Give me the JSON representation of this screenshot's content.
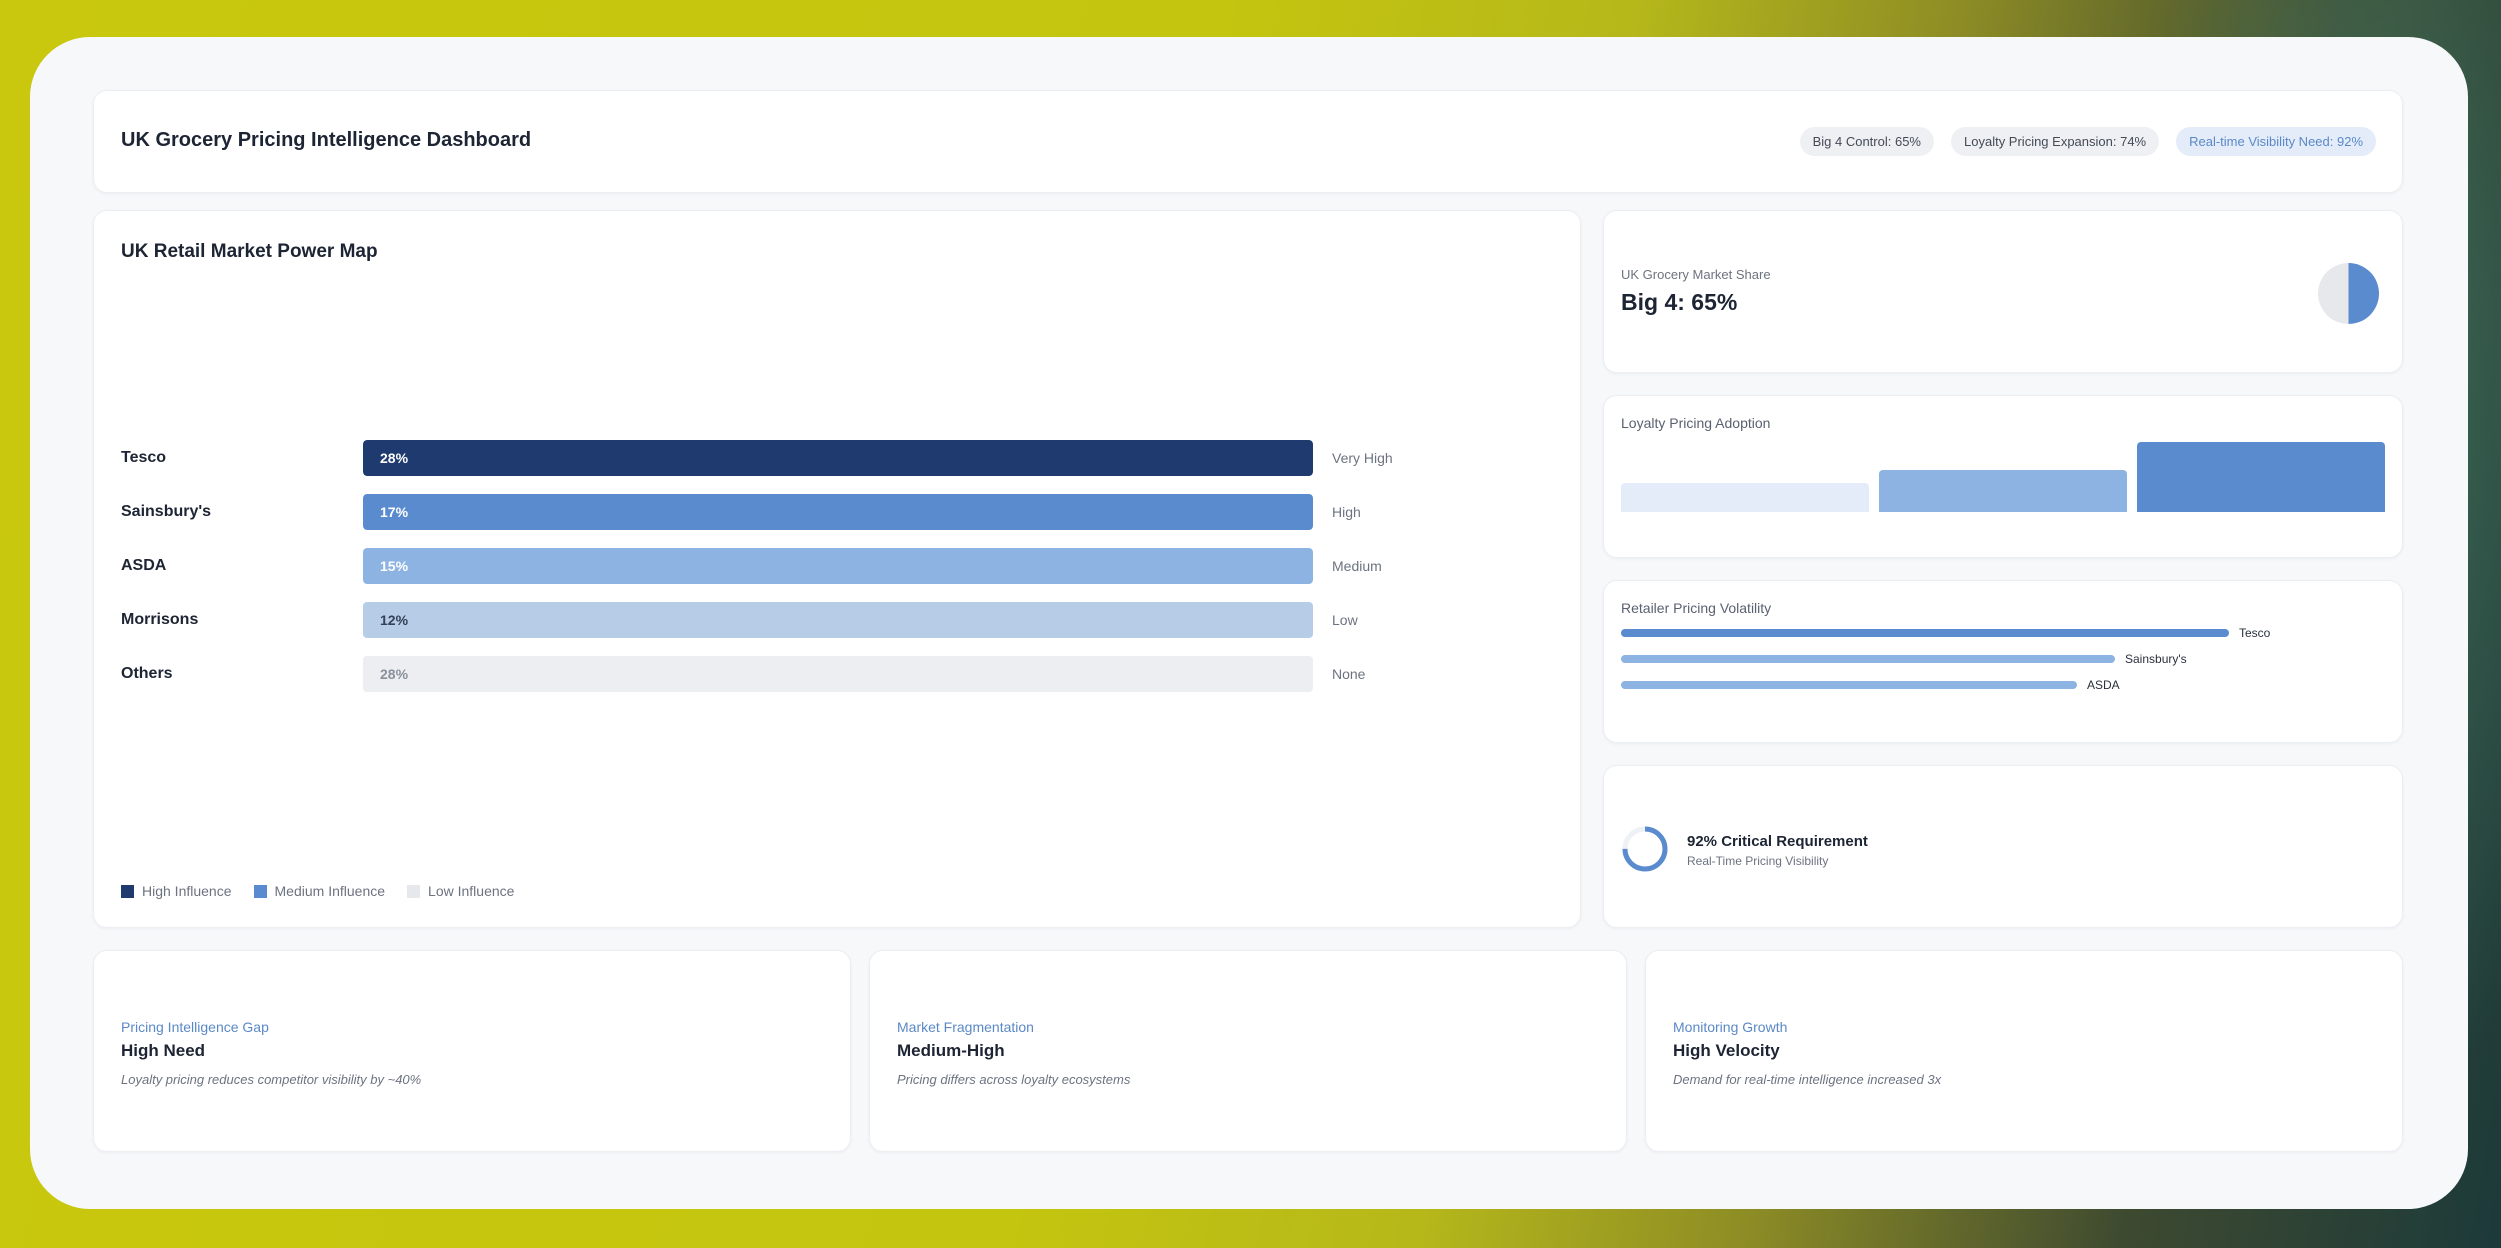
{
  "colors": {
    "high": "#1e3a6e",
    "medium": "#5a8bcf",
    "medium_light": "#8db3e2",
    "low": "#b7cce6",
    "none": "#eceef2",
    "accent": "#5b89c7"
  },
  "header": {
    "title": "UK Grocery Pricing Intelligence Dashboard",
    "pills": [
      {
        "label": "Big 4 Control: 65%"
      },
      {
        "label": "Loyalty Pricing Expansion: 74%"
      },
      {
        "label": "Real-time Visibility Need: 92%"
      }
    ]
  },
  "power_map": {
    "title": "UK Retail Market Power Map",
    "rows": [
      {
        "name": "Tesco",
        "value_label": "28%",
        "fill": 1.0,
        "level": "Very High",
        "color": "#1e3a6e",
        "text_color": "#ffffff"
      },
      {
        "name": "Sainsbury's",
        "value_label": "17%",
        "fill": 1.0,
        "level": "High",
        "color": "#5a8bcf",
        "text_color": "#ffffff"
      },
      {
        "name": "ASDA",
        "value_label": "15%",
        "fill": 1.0,
        "level": "Medium",
        "color": "#8db3e2",
        "text_color": "#ffffff"
      },
      {
        "name": "Morrisons",
        "value_label": "12%",
        "fill": 1.0,
        "level": "Low",
        "color": "#b7cce6",
        "text_color": "#33415a"
      },
      {
        "name": "Others",
        "value_label": "28%",
        "fill": 1.0,
        "level": "None",
        "color": "#eceef2",
        "text_color": "#8a909b"
      }
    ],
    "legend": [
      {
        "label": "High Influence",
        "color": "#1e3a6e"
      },
      {
        "label": "Medium Influence",
        "color": "#5a8bcf"
      },
      {
        "label": "Low Influence",
        "color": "#e6e8ec"
      }
    ]
  },
  "market_share": {
    "label": "UK Grocery Market Share",
    "value": "Big 4: 65%",
    "pie_fraction": 0.5
  },
  "loyalty": {
    "title": "Loyalty Pricing Adoption",
    "bars": [
      {
        "value": 0.42,
        "color": "#e3ecf8"
      },
      {
        "value": 0.6,
        "color": "#8db3e2"
      },
      {
        "value": 1.0,
        "color": "#5a8bcf"
      }
    ]
  },
  "volatility": {
    "title": "Retailer Pricing Volatility",
    "lines": [
      {
        "name": "Tesco",
        "value": 0.8,
        "color": "#5a8bcf"
      },
      {
        "name": "Sainsbury's",
        "value": 0.65,
        "color": "#8db3e2"
      },
      {
        "name": "ASDA",
        "value": 0.6,
        "color": "#8db3e2"
      }
    ]
  },
  "critical": {
    "title": "92% Critical Requirement",
    "subtitle": "Real-Time Pricing Visibility",
    "value": 0.75
  },
  "info_cards": [
    {
      "kicker": "Pricing Intelligence Gap",
      "value": "High Need",
      "note": "Loyalty pricing reduces competitor visibility by ~40%"
    },
    {
      "kicker": "Market Fragmentation",
      "value": "Medium-High",
      "note": "Pricing differs across loyalty ecosystems"
    },
    {
      "kicker": "Monitoring Growth",
      "value": "High Velocity",
      "note": "Demand for real-time intelligence increased 3x"
    }
  ]
}
